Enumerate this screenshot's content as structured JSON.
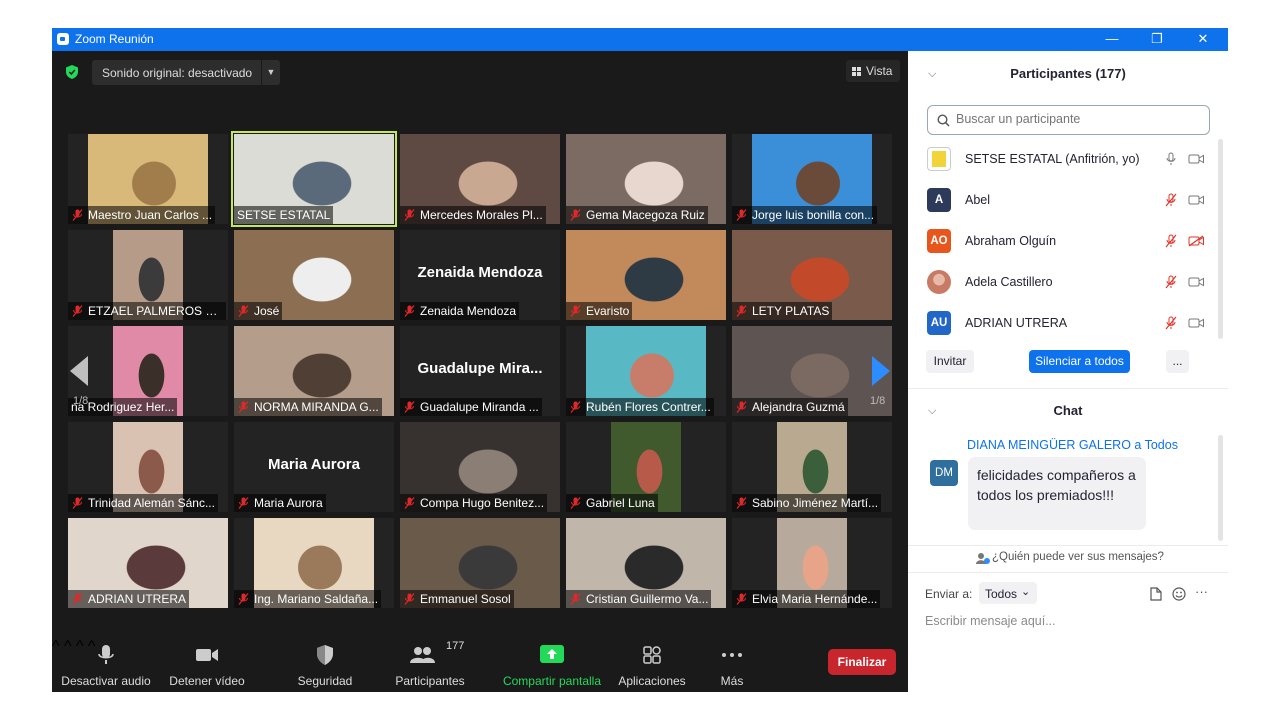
{
  "window": {
    "title": "Zoom Reunión",
    "controls": [
      "minimize",
      "restore",
      "close"
    ]
  },
  "meeting": {
    "sound_label": "Sonido original: desactivado",
    "view_label": "Vista",
    "page_left": "1/8",
    "page_right": "1/8",
    "accent": "#c3e85a"
  },
  "tiles": [
    {
      "name": "Maestro Juan Carlos ...",
      "has_video": true,
      "muted": true
    },
    {
      "name": "SETSE ESTATAL",
      "has_video": true,
      "muted": false,
      "active": true
    },
    {
      "name": "Mercedes Morales Pl...",
      "has_video": true,
      "muted": true
    },
    {
      "name": "Gema Macegoza Ruiz",
      "has_video": true,
      "muted": true
    },
    {
      "name": "Jorge luis bonilla con...",
      "has_video": true,
      "muted": true
    },
    {
      "name": "ETZAEL PALMEROS G...",
      "has_video": true,
      "muted": true
    },
    {
      "name": "José",
      "has_video": true,
      "muted": true
    },
    {
      "name": "Zenaida Mendoza",
      "big_name": "Zenaida Mendoza",
      "has_video": false,
      "muted": true
    },
    {
      "name": "Evaristo",
      "has_video": true,
      "muted": true
    },
    {
      "name": "LETY PLATAS",
      "has_video": true,
      "muted": true
    },
    {
      "name": "na Rodriguez Her...",
      "has_video": true,
      "muted": false
    },
    {
      "name": "NORMA MIRANDA G...",
      "has_video": true,
      "muted": true
    },
    {
      "name": "Guadalupe Miranda ...",
      "big_name": "Guadalupe  Mira...",
      "has_video": false,
      "muted": true
    },
    {
      "name": "Rubén Flores Contrer...",
      "has_video": true,
      "muted": true
    },
    {
      "name": "Alejandra Guzmá",
      "has_video": true,
      "muted": true
    },
    {
      "name": "Trinidad Alemán Sánc...",
      "has_video": true,
      "muted": true
    },
    {
      "name": "Maria Aurora",
      "big_name": "Maria Aurora",
      "has_video": false,
      "muted": true
    },
    {
      "name": "Compa Hugo Benitez...",
      "has_video": true,
      "muted": true
    },
    {
      "name": "Gabriel Luna",
      "has_video": true,
      "muted": true
    },
    {
      "name": "Sabino Jiménez Martí...",
      "has_video": true,
      "muted": true
    },
    {
      "name": "ADRIAN UTRERA",
      "has_video": true,
      "muted": true
    },
    {
      "name": "Ing. Mariano Saldaña...",
      "has_video": true,
      "muted": true
    },
    {
      "name": "Emmanuel Sosol",
      "has_video": true,
      "muted": true
    },
    {
      "name": "Cristian Guillermo Va...",
      "has_video": true,
      "muted": true
    },
    {
      "name": "Elvia Maria Hernánde...",
      "has_video": true,
      "muted": true
    }
  ],
  "toolbar": {
    "audio": "Desactivar audio",
    "video": "Detener vídeo",
    "security": "Seguridad",
    "participants": "Participantes",
    "participants_count": "177",
    "share": "Compartir pantalla",
    "apps": "Aplicaciones",
    "more": "Más",
    "end": "Finalizar",
    "share_color": "#23d959",
    "end_color": "#c9252c"
  },
  "participants_panel": {
    "title": "Participantes (177)",
    "search_placeholder": "Buscar un participante",
    "list": [
      {
        "name": "SETSE ESTATAL (Anfitrión, yo)",
        "avatar": "logo",
        "mic": "on",
        "cam": "on"
      },
      {
        "name": "Abel",
        "initials": "A",
        "avatar_color": "#2d3a5a",
        "mic": "off",
        "cam": "on"
      },
      {
        "name": "Abraham Olguín",
        "initials": "AO",
        "avatar_color": "#e8561e",
        "mic": "off",
        "cam": "off"
      },
      {
        "name": "Adela Castillero",
        "avatar": "photo",
        "mic": "off",
        "cam": "on"
      },
      {
        "name": "ADRIAN UTRERA",
        "initials": "AU",
        "avatar_color": "#2266c8",
        "mic": "off",
        "cam": "on"
      }
    ],
    "invite": "Invitar",
    "mute_all": "Silenciar a todos",
    "more": "..."
  },
  "chat": {
    "title": "Chat",
    "messages": [
      {
        "sender": "DIANA MEINGÜER GALERO a Todos",
        "initials": "DM",
        "text": "felicidades compañeros a todos los premiados!!!"
      }
    ],
    "visibility": "¿Quién puede ver sus mensajes?",
    "send_to_label": "Enviar a:",
    "send_to_value": "Todos",
    "input_placeholder": "Escribir mensaje aquí..."
  }
}
